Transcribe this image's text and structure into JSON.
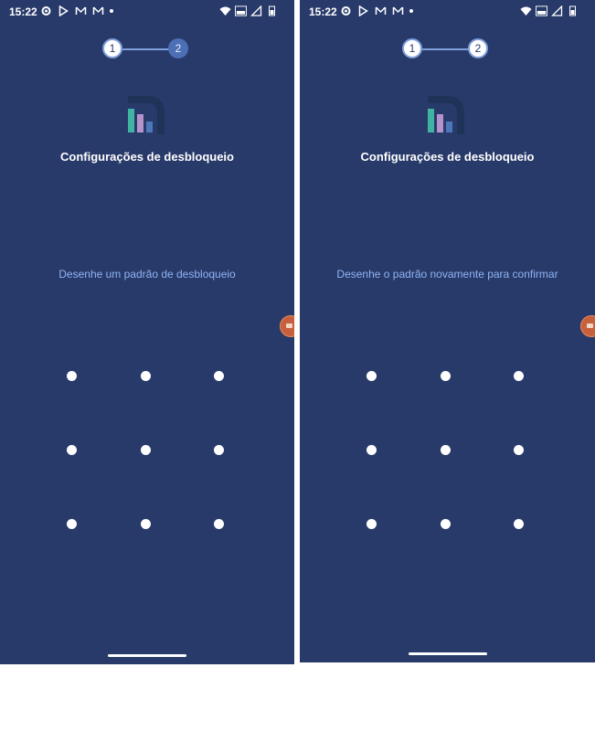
{
  "screens": [
    {
      "status_bar": {
        "time": "15:22",
        "icons": [
          "gear-icon",
          "play-store-icon",
          "gmail-icon",
          "gmail-icon",
          "dot-icon"
        ],
        "right_icons": [
          "wifi-icon",
          "volte-icon",
          "signal-icon",
          "battery-icon"
        ]
      },
      "stepper": {
        "step1": "1",
        "step2": "2",
        "active_step": 1
      },
      "title": "Configurações de desbloqueio",
      "instruction": "Desenhe um padrão de desbloqueio"
    },
    {
      "status_bar": {
        "time": "15:22",
        "icons": [
          "gear-icon",
          "play-store-icon",
          "gmail-icon",
          "gmail-icon",
          "dot-icon"
        ],
        "right_icons": [
          "wifi-icon",
          "volte-icon",
          "signal-icon",
          "battery-icon"
        ]
      },
      "stepper": {
        "step1": "1",
        "step2": "2",
        "active_step": 2
      },
      "title": "Configurações de desbloqueio",
      "instruction": "Desenhe o padrão novamente para confirmar"
    }
  ],
  "colors": {
    "background": "#283a6a",
    "instruction": "#8fb4f2",
    "step_active": "#4d6fb5",
    "handle": "#c8603d"
  },
  "pattern": {
    "rows": 3,
    "cols": 3
  }
}
